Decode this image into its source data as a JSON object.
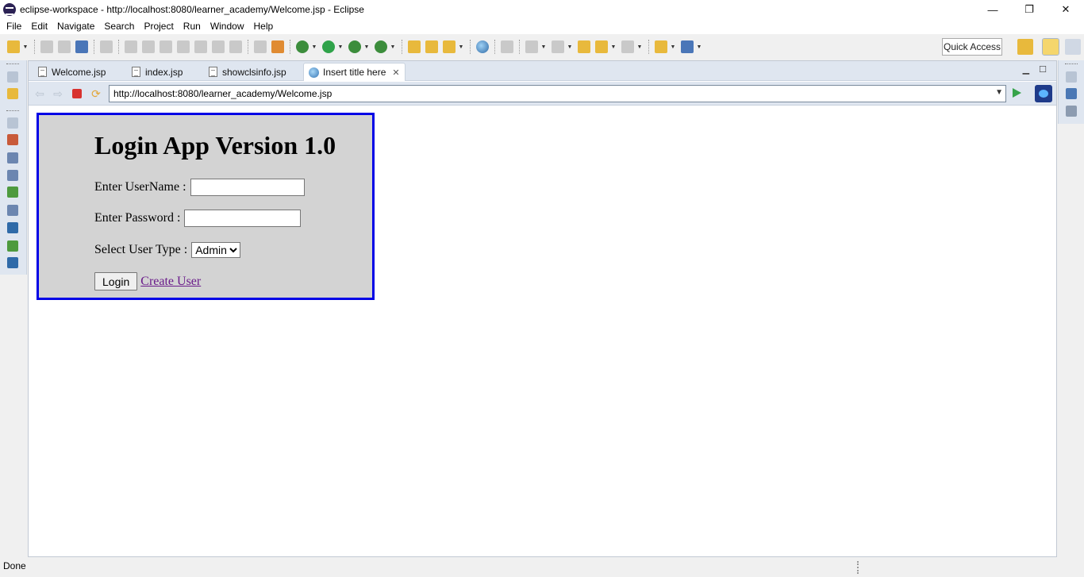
{
  "window": {
    "title": "eclipse-workspace - http://localhost:8080/learner_academy/Welcome.jsp - Eclipse",
    "minimize": "—",
    "restore": "❐",
    "close": "✕"
  },
  "menu": [
    "File",
    "Edit",
    "Navigate",
    "Search",
    "Project",
    "Run",
    "Window",
    "Help"
  ],
  "toolbar": {
    "quick_access": "Quick Access"
  },
  "tabs": [
    {
      "label": "Welcome.jsp",
      "active": false
    },
    {
      "label": "index.jsp",
      "active": false
    },
    {
      "label": "showclsinfo.jsp",
      "active": false
    },
    {
      "label": "Insert title here",
      "active": true
    }
  ],
  "browser": {
    "url": "http://localhost:8080/learner_academy/Welcome.jsp"
  },
  "login": {
    "heading": "Login App Version 1.0",
    "username_label": "Enter UserName :",
    "username_value": "",
    "password_label": "Enter Password :",
    "password_value": "",
    "usertype_label": "Select User Type :",
    "usertype_selected": "Admin",
    "login_button": "Login",
    "create_user_link": "Create User",
    "border_color": "#0000e6",
    "background_color": "#d3d3d3"
  },
  "status": {
    "text": "Done"
  },
  "icons": {
    "app": "eclipse-icon",
    "tab_file": "jsp-file-icon",
    "tab_active": "globe-icon"
  }
}
